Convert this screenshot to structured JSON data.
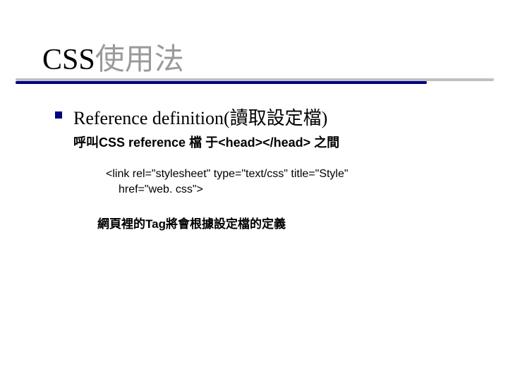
{
  "title": {
    "en": "CSS",
    "zh": "使用法"
  },
  "bullet1": {
    "en": "Reference definition",
    "paren": "(讀取設定檔)"
  },
  "sub1": "呼叫CSS reference 檔 于<head></head> 之間",
  "code": {
    "line1": "<link rel=\"stylesheet\" type=\"text/css\" title=\"Style\"",
    "line2": "href=\"web. css\">"
  },
  "note": "網頁裡的Tag將會根據設定檔的定義"
}
